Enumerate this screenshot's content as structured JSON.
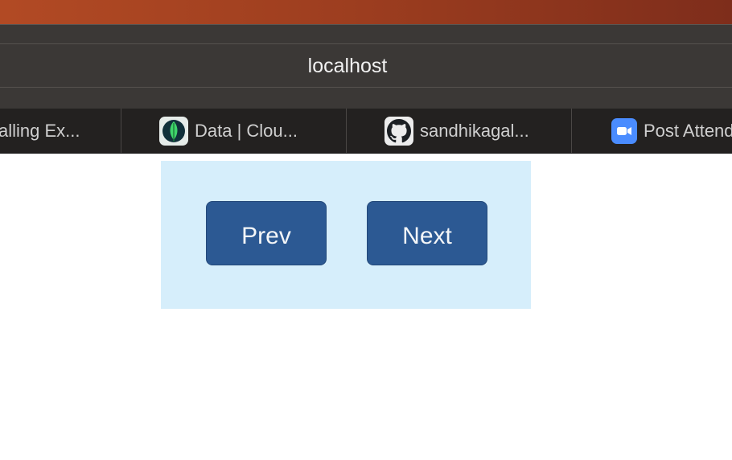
{
  "browser": {
    "address_bar": {
      "url": "localhost"
    },
    "bookmarks": [
      {
        "label": "alling Ex...",
        "icon": "none"
      },
      {
        "label": "Data | Clou...",
        "icon": "mongodb-leaf-icon"
      },
      {
        "label": "sandhikagal...",
        "icon": "github-icon"
      },
      {
        "label": "Post Attend",
        "icon": "zoom-video-icon"
      }
    ]
  },
  "page": {
    "pagination": {
      "prev_label": "Prev",
      "next_label": "Next"
    }
  },
  "colors": {
    "panel_bg": "#d6eefb",
    "button_bg": "#2c5993",
    "toolbar_bg": "#3b3836",
    "tabbar_bg": "#232120"
  }
}
